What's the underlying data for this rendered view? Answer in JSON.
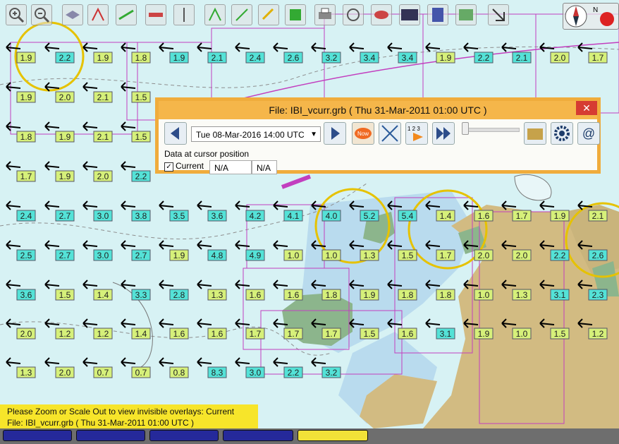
{
  "chart": {
    "colors": {
      "sea": "#d7f2f4",
      "land": "#d2bb82",
      "shallow": "#b7d9ea",
      "green": "#8cb58c",
      "box_green": "#d6f07a",
      "box_cyan": "#54e2d7",
      "magenta": "#c23fbf"
    },
    "current_values": [
      {
        "v": "1.9",
        "c": "g"
      },
      {
        "v": "2.2",
        "c": "c"
      },
      {
        "v": "1.9",
        "c": "g"
      },
      {
        "v": "1.8",
        "c": "g"
      },
      {
        "v": "1.9",
        "c": "c"
      },
      {
        "v": "2.1",
        "c": "c"
      },
      {
        "v": "2.4",
        "c": "c"
      },
      {
        "v": "2.6",
        "c": "c"
      },
      {
        "v": "3.2",
        "c": "c"
      },
      {
        "v": "3.4",
        "c": "c"
      },
      {
        "v": "3.4",
        "c": "c"
      },
      {
        "v": "1.9",
        "c": "g"
      },
      {
        "v": "2.2",
        "c": "c"
      },
      {
        "v": "2.1",
        "c": "c"
      },
      {
        "v": "2.0",
        "c": "g"
      },
      {
        "v": "1.7",
        "c": "g"
      },
      {
        "v": "1.9",
        "c": "g"
      },
      {
        "v": "2.0",
        "c": "g"
      },
      {
        "v": "2.1",
        "c": "g"
      },
      {
        "v": "1.5",
        "c": "g"
      },
      {
        "v": "1.8",
        "c": "g"
      },
      {
        "v": "1.9",
        "c": "g"
      },
      {
        "v": "2.1",
        "c": "g"
      },
      {
        "v": "1.5",
        "c": "g"
      },
      {
        "v": "1.7",
        "c": "g"
      },
      {
        "v": "1.9",
        "c": "g"
      },
      {
        "v": "2.0",
        "c": "g"
      },
      {
        "v": "2.2",
        "c": "c"
      },
      {
        "v": "2.4",
        "c": "c"
      },
      {
        "v": "2.7",
        "c": "c"
      },
      {
        "v": "3.0",
        "c": "c"
      },
      {
        "v": "3.8",
        "c": "c"
      },
      {
        "v": "3.5",
        "c": "c"
      },
      {
        "v": "3.6",
        "c": "c"
      },
      {
        "v": "4.2",
        "c": "c"
      },
      {
        "v": "4.1",
        "c": "c"
      },
      {
        "v": "4.0",
        "c": "c"
      },
      {
        "v": "5.2",
        "c": "c"
      },
      {
        "v": "5.4",
        "c": "c"
      },
      {
        "v": "1.4",
        "c": "g"
      },
      {
        "v": "1.6",
        "c": "g"
      },
      {
        "v": "1.7",
        "c": "g"
      },
      {
        "v": "1.9",
        "c": "g"
      },
      {
        "v": "2.1",
        "c": "g"
      },
      {
        "v": "2.5",
        "c": "c"
      },
      {
        "v": "2.7",
        "c": "c"
      },
      {
        "v": "3.0",
        "c": "c"
      },
      {
        "v": "2.7",
        "c": "c"
      },
      {
        "v": "1.9",
        "c": "g"
      },
      {
        "v": "4.8",
        "c": "c"
      },
      {
        "v": "4.9",
        "c": "c"
      },
      {
        "v": "1.0",
        "c": "g"
      },
      {
        "v": "1.0",
        "c": "g"
      },
      {
        "v": "1.3",
        "c": "g"
      },
      {
        "v": "1.5",
        "c": "g"
      },
      {
        "v": "1.7",
        "c": "g"
      },
      {
        "v": "2.0",
        "c": "g"
      },
      {
        "v": "2.0",
        "c": "g"
      },
      {
        "v": "2.2",
        "c": "c"
      },
      {
        "v": "2.6",
        "c": "c"
      },
      {
        "v": "3.6",
        "c": "c"
      },
      {
        "v": "1.5",
        "c": "g"
      },
      {
        "v": "1.4",
        "c": "g"
      },
      {
        "v": "3.3",
        "c": "c"
      },
      {
        "v": "2.8",
        "c": "c"
      },
      {
        "v": "1.3",
        "c": "g"
      },
      {
        "v": "1.6",
        "c": "g"
      },
      {
        "v": "1.6",
        "c": "g"
      },
      {
        "v": "1.8",
        "c": "g"
      },
      {
        "v": "1.9",
        "c": "g"
      },
      {
        "v": "1.8",
        "c": "g"
      },
      {
        "v": "1.8",
        "c": "g"
      },
      {
        "v": "1.0",
        "c": "g"
      },
      {
        "v": "1.3",
        "c": "g"
      },
      {
        "v": "3.1",
        "c": "c"
      },
      {
        "v": "2.3",
        "c": "c"
      },
      {
        "v": "2.0",
        "c": "g"
      },
      {
        "v": "1.2",
        "c": "g"
      },
      {
        "v": "1.2",
        "c": "g"
      },
      {
        "v": "1.4",
        "c": "g"
      },
      {
        "v": "1.6",
        "c": "g"
      },
      {
        "v": "1.6",
        "c": "g"
      },
      {
        "v": "1.7",
        "c": "g"
      },
      {
        "v": "1.7",
        "c": "g"
      },
      {
        "v": "1.7",
        "c": "g"
      },
      {
        "v": "1.5",
        "c": "g"
      },
      {
        "v": "1.6",
        "c": "g"
      },
      {
        "v": "3.1",
        "c": "c"
      },
      {
        "v": "1.9",
        "c": "g"
      },
      {
        "v": "1.0",
        "c": "g"
      },
      {
        "v": "1.5",
        "c": "g"
      },
      {
        "v": "1.2",
        "c": "g"
      },
      {
        "v": "1.3",
        "c": "g"
      },
      {
        "v": "2.0",
        "c": "g"
      },
      {
        "v": "0.7",
        "c": "g"
      },
      {
        "v": "0.7",
        "c": "g"
      },
      {
        "v": "0.8",
        "c": "g"
      },
      {
        "v": "8.3",
        "c": "c"
      },
      {
        "v": "3.0",
        "c": "c"
      },
      {
        "v": "2.2",
        "c": "c"
      },
      {
        "v": "3.2",
        "c": "c"
      }
    ]
  },
  "toolbar": {
    "buttons": [
      "zoom-in",
      "zoom-out",
      "layer",
      "route",
      "track",
      "measure",
      "route-new",
      "waypoint",
      "tools",
      "print",
      "ais",
      "settings",
      "scale",
      "grib",
      "current",
      "tide",
      "exit"
    ]
  },
  "grib": {
    "title": "File: IBI_vcurr.grb ( Thu 31-Mar-2011 01:00  UTC )",
    "close": "✕",
    "date": "Tue 08-Mar-2016 14:00  UTC",
    "now": "Now",
    "interval": "1 2 3",
    "cursor_label": "Data at cursor position",
    "current_label": "Current",
    "value1": "N/A",
    "value2": "N/A"
  },
  "status": {
    "line1": "Please Zoom or Scale Out to view invisible overlays: Current",
    "line2": "File: IBI_vcurr.grb ( Thu 31-Mar-2011 01:00  UTC )"
  },
  "piano": {
    "colors": [
      "#25299a",
      "#25299a",
      "#25299a",
      "#25299a",
      "#f2e238"
    ]
  }
}
